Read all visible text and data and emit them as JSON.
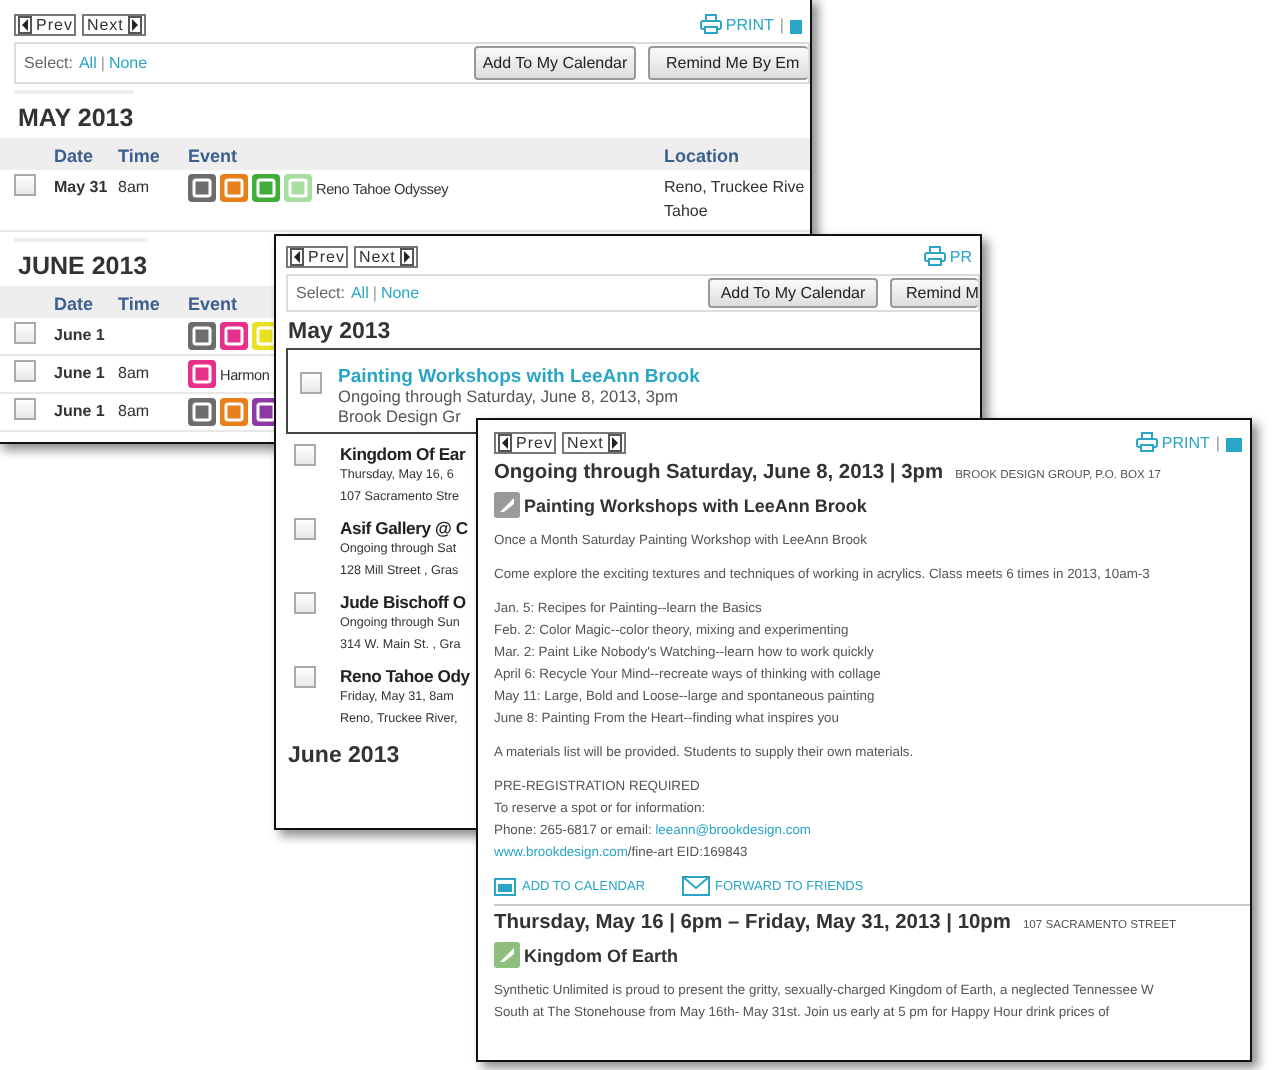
{
  "calendar_list": {
    "nav": [
      "Prev",
      "Next"
    ],
    "print": "PRINT",
    "print_separator": "|",
    "select_label": "Select:",
    "select_all": "All",
    "select_separator": "|",
    "select_none": "None",
    "buttons": [
      "Add To My Calendar",
      "Remind Me By Em"
    ],
    "sections": [
      {
        "heading": "MAY 2013",
        "columns": [
          "Date",
          "Time",
          "Event",
          "Location"
        ],
        "rows": [
          {
            "checked": false,
            "date": "May 31",
            "time": "8am",
            "icons": [
              {
                "color": "#6d6d6d"
              },
              {
                "color": "#e8801a"
              },
              {
                "color": "#3fae3a"
              },
              {
                "color": "#a8dca0"
              }
            ],
            "event": "Reno Tahoe Odyssey",
            "location": [
              "Reno, Truckee Rive",
              "Tahoe"
            ]
          }
        ]
      },
      {
        "heading": "JUNE 2013",
        "columns": [
          "Date",
          "Time",
          "Event"
        ],
        "rows": [
          {
            "checked": false,
            "date": "June 1",
            "time": "",
            "icons": [
              {
                "color": "#6d6d6d"
              },
              {
                "color": "#e6308a"
              },
              {
                "color": "#e8e020"
              }
            ],
            "event": "",
            "location": []
          },
          {
            "checked": false,
            "date": "June 1",
            "time": "8am",
            "icons": [
              {
                "color": "#e6308a"
              }
            ],
            "event": "Harmon",
            "location": []
          },
          {
            "checked": false,
            "date": "June 1",
            "time": "8am",
            "icons": [
              {
                "color": "#6d6d6d"
              },
              {
                "color": "#e8801a"
              },
              {
                "color": "#8e3aa6"
              }
            ],
            "event": "",
            "location": []
          }
        ]
      }
    ]
  },
  "event_list": {
    "nav": [
      "Prev",
      "Next"
    ],
    "print": "PR",
    "select_label": "Select:",
    "select_all": "All",
    "select_separator": "|",
    "select_none": "None",
    "buttons": [
      "Add To My Calendar",
      "Remind M"
    ],
    "heading": "May 2013",
    "featured": {
      "checked": false,
      "title": "Painting Workshops with LeeAnn Brook",
      "lines": [
        "Ongoing through Saturday, June 8, 2013, 3pm",
        "Brook Design Gr"
      ]
    },
    "items": [
      {
        "checked": false,
        "title": "Kingdom Of Ear",
        "lines": [
          "Thursday, May 16, 6",
          "107 Sacramento Stre"
        ]
      },
      {
        "checked": false,
        "title": "Asif Gallery @ C",
        "lines": [
          "Ongoing through Sat",
          "128 Mill Street , Gras"
        ]
      },
      {
        "checked": false,
        "title": "Jude Bischoff O",
        "lines": [
          "Ongoing through Sun",
          "314 W. Main St. , Gra"
        ]
      },
      {
        "checked": false,
        "title": "Reno Tahoe Ody",
        "lines": [
          "Friday, May 31, 8am",
          "Reno, Truckee River,"
        ]
      }
    ],
    "next_heading": "June 2013"
  },
  "event_detail": {
    "nav": [
      "Prev",
      "Next"
    ],
    "print": "PRINT",
    "print_separator": "|",
    "events": [
      {
        "when": "Ongoing through Saturday, June 8, 2013 | 3pm",
        "venue": "BROOK DESIGN GROUP, P.O. BOX 17",
        "title": "Painting Workshops with LeeAnn Brook",
        "color": "#9a9a9a",
        "paragraphs": [
          [
            "Once a Month Saturday Painting Workshop with LeeAnn Brook"
          ],
          [
            "Come explore the exciting textures and techniques of working in acrylics. Class meets 6 times in 2013, 10am-3"
          ],
          [
            "Jan. 5: Recipes for Painting--learn the Basics",
            "Feb. 2: Color Magic--color theory, mixing and experimenting",
            "Mar. 2: Paint Like Nobody's Watching--learn how to work quickly",
            "April 6: Recycle Your Mind--recreate ways of thinking with collage",
            "May 11: Large, Bold and Loose--large and spontaneous painting",
            "June 8: Painting From the Heart--finding what inspires you"
          ],
          [
            "A materials list will be provided. Students to supply their own materials."
          ],
          [
            "PRE-REGISTRATION REQUIRED",
            "To reserve a spot or for information:"
          ]
        ],
        "contact": {
          "phone_text": "Phone: 265-6817 or email:",
          "email": "leeann@brookdesign.com",
          "website": "www.brookdesign.com",
          "website_suffix": "/fine-art EID:169843"
        },
        "actions": [
          "ADD TO CALENDAR",
          "FORWARD TO FRIENDS"
        ]
      },
      {
        "when": "Thursday, May 16 | 6pm – Friday, May 31, 2013 | 10pm",
        "venue": "107 SACRAMENTO STREET",
        "title": "Kingdom Of Earth",
        "color": "#8fbf7f",
        "paragraphs": [
          [
            "Synthetic Unlimited is proud to present the gritty, sexually-charged Kingdom of Earth, a neglected Tennessee W",
            "South at The Stonehouse from May 16th- May 31st. Join us early at 5 pm for Happy Hour drink prices of"
          ]
        ]
      }
    ]
  }
}
